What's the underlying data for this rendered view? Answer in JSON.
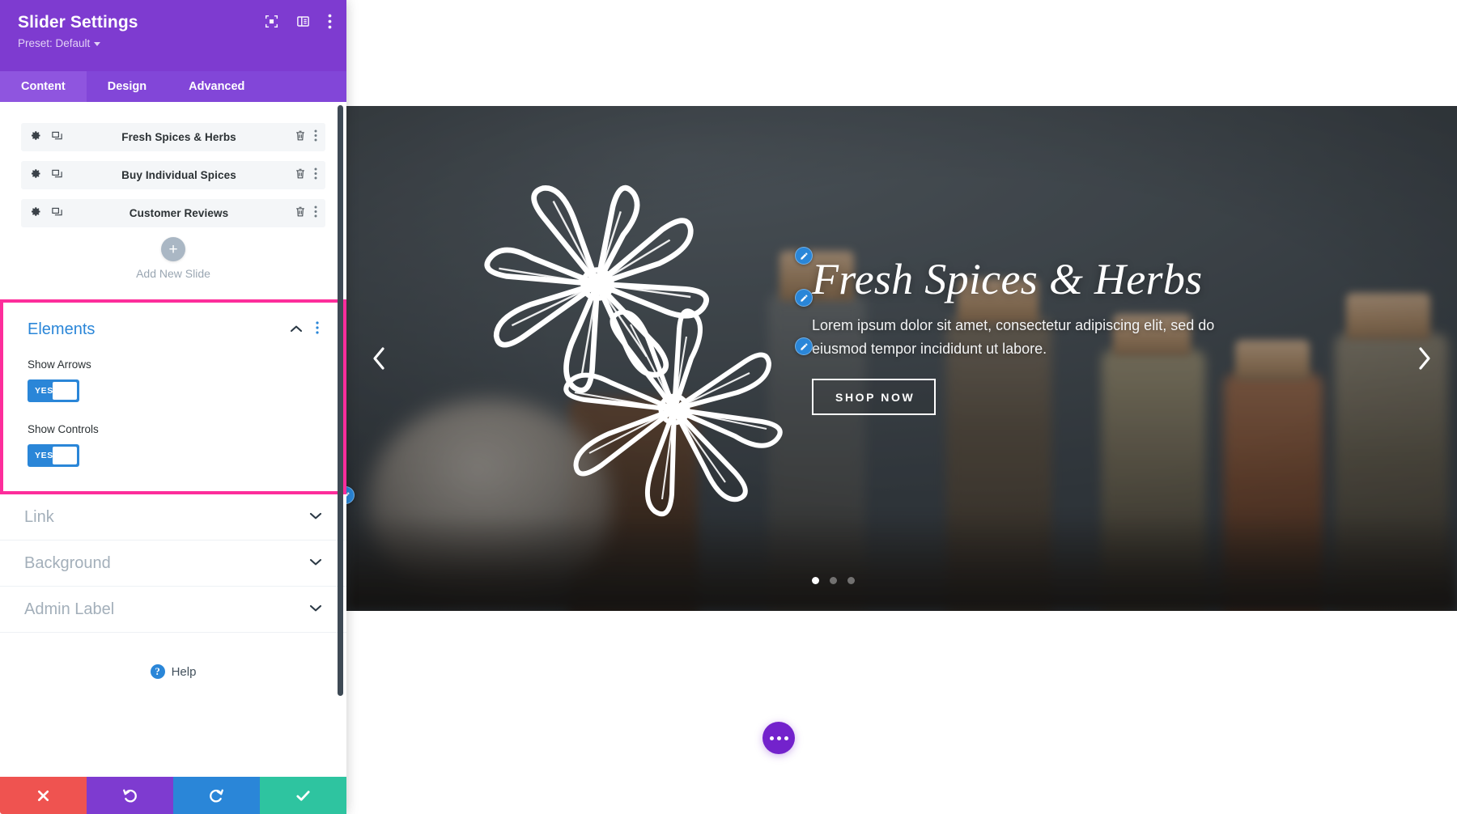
{
  "panel": {
    "title": "Slider Settings",
    "preset_label": "Preset: Default",
    "header_icons": [
      {
        "name": "focus-icon"
      },
      {
        "name": "layout-panel-icon"
      },
      {
        "name": "kebab-menu-icon"
      }
    ],
    "tabs": [
      {
        "label": "Content",
        "active": true
      },
      {
        "label": "Design",
        "active": false
      },
      {
        "label": "Advanced",
        "active": false
      }
    ],
    "slides": [
      {
        "name": "Fresh Spices & Herbs"
      },
      {
        "name": "Buy Individual Spices"
      },
      {
        "name": "Customer Reviews"
      }
    ],
    "add_slide_label": "Add New Slide",
    "add_slide_glyph": "+",
    "elements_section": {
      "title": "Elements",
      "highlight_color": "#fd2d9b",
      "accent_color": "#2a86d8",
      "fields": [
        {
          "label": "Show Arrows",
          "value": "YES"
        },
        {
          "label": "Show Controls",
          "value": "YES"
        }
      ]
    },
    "closed_sections": [
      {
        "title": "Link"
      },
      {
        "title": "Background"
      },
      {
        "title": "Admin Label"
      }
    ],
    "help": {
      "label": "Help",
      "glyph": "?"
    },
    "footer_buttons": [
      {
        "name": "discard-button",
        "color": "#ef5350",
        "icon": "close-icon"
      },
      {
        "name": "undo-button",
        "color": "#7e3bd0",
        "icon": "undo-icon"
      },
      {
        "name": "redo-button",
        "color": "#2a86d8",
        "icon": "redo-icon"
      },
      {
        "name": "save-button",
        "color": "#2ec4a0",
        "icon": "check-icon"
      }
    ]
  },
  "slider": {
    "heading": "Fresh Spices & Herbs",
    "paragraph": "Lorem ipsum dolor sit amet, consectetur adipiscing elit, sed do eiusmod tempor incididunt ut labore.",
    "button_label": "SHOP NOW",
    "dots": [
      {
        "active": true
      },
      {
        "active": false
      },
      {
        "active": false
      }
    ],
    "prev_arrow": "chevron-left-icon",
    "next_arrow": "chevron-right-icon",
    "background_art": "star-anise-line-art"
  },
  "page_fab": {
    "name": "builder-menu-fab",
    "color": "#7322cc"
  }
}
